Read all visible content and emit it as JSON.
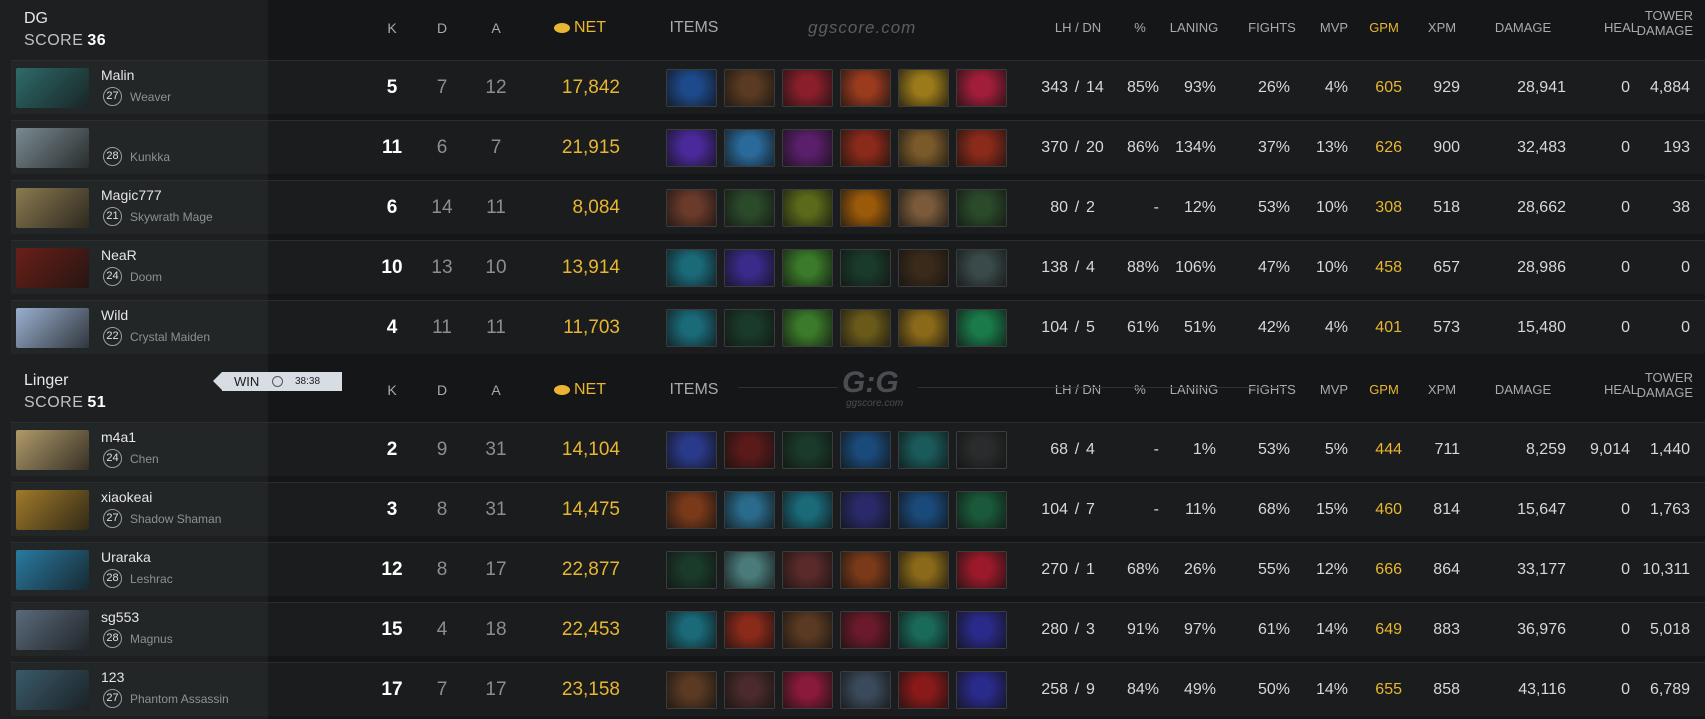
{
  "headers": {
    "k": "K",
    "d": "D",
    "a": "A",
    "net": "NET",
    "items": "ITEMS",
    "lhdn": "LH / DN",
    "pct": "%",
    "laning": "LANING",
    "fights": "FIGHTS",
    "mvp": "MVP",
    "gpm": "GPM",
    "xpm": "XPM",
    "damage": "DAMAGE",
    "heal": "HEAL",
    "tower1": "TOWER",
    "tower2": "DAMAGE"
  },
  "logo_top": "ggscore.com",
  "logo_mid": "G:G",
  "logo_mid_sub": "ggscore.com",
  "match": {
    "result": "WIN",
    "time": "38:38"
  },
  "teams": [
    {
      "name": "DG",
      "score_label": "SCORE",
      "score": "36",
      "players": [
        {
          "name": "Malin",
          "level": "27",
          "hero": "Weaver",
          "k": "5",
          "d": "7",
          "a": "12",
          "net": "17,842",
          "lh": "343",
          "dn": "14",
          "pct": "85%",
          "laning": "93%",
          "fights": "26%",
          "mvp": "4%",
          "gpm": "605",
          "xpm": "929",
          "damage": "28,941",
          "heal": "0",
          "tower": "4,884",
          "portrait": "#2f6a6a",
          "items": [
            "#1d4a8a",
            "#5a3a22",
            "#8a1f2a",
            "#9a3b1e",
            "#9a7a1a",
            "#a01e3a"
          ]
        },
        {
          "name": "",
          "level": "28",
          "hero": "Kunkka",
          "k": "11",
          "d": "6",
          "a": "7",
          "net": "21,915",
          "lh": "370",
          "dn": "20",
          "pct": "86%",
          "laning": "134%",
          "fights": "37%",
          "mvp": "13%",
          "gpm": "626",
          "xpm": "900",
          "damage": "32,483",
          "heal": "0",
          "tower": "193",
          "portrait": "#7a8a90",
          "items": [
            "#4a2a9a",
            "#2a6a9a",
            "#5a1f6a",
            "#8a2a1a",
            "#7a5a2a",
            "#8a2a1a"
          ]
        },
        {
          "name": "Magic777",
          "level": "21",
          "hero": "Skywrath Mage",
          "k": "6",
          "d": "14",
          "a": "11",
          "net": "8,084",
          "lh": "80",
          "dn": "2",
          "pct": "-",
          "laning": "12%",
          "fights": "53%",
          "mvp": "10%",
          "gpm": "308",
          "xpm": "518",
          "damage": "28,662",
          "heal": "0",
          "tower": "38",
          "portrait": "#8a7a50",
          "items": [
            "#6a3a2a",
            "#2a4a2a",
            "#5a6a1a",
            "#9a5a0a",
            "#7a5a3a",
            "#2a4a2a"
          ]
        },
        {
          "name": "NeaR",
          "level": "24",
          "hero": "Doom",
          "k": "10",
          "d": "13",
          "a": "10",
          "net": "13,914",
          "lh": "138",
          "dn": "4",
          "pct": "88%",
          "laning": "106%",
          "fights": "47%",
          "mvp": "10%",
          "gpm": "458",
          "xpm": "657",
          "damage": "28,986",
          "heal": "0",
          "tower": "0",
          "portrait": "#6a2018",
          "items": [
            "#1a6a7a",
            "#3a2a8a",
            "#3a7a2a",
            "#1a3a2a",
            "#3a2a1a",
            "#3a4a4a"
          ]
        },
        {
          "name": "Wild",
          "level": "22",
          "hero": "Crystal Maiden",
          "k": "4",
          "d": "11",
          "a": "11",
          "net": "11,703",
          "lh": "104",
          "dn": "5",
          "pct": "61%",
          "laning": "51%",
          "fights": "42%",
          "mvp": "4%",
          "gpm": "401",
          "xpm": "573",
          "damage": "15,480",
          "heal": "0",
          "tower": "0",
          "portrait": "#9ab0d0",
          "items": [
            "#1a6a7a",
            "#1a3a2a",
            "#3a7a2a",
            "#6a5a1a",
            "#8a6a1a",
            "#1a7a4a"
          ]
        }
      ]
    },
    {
      "name": "Linger",
      "score_label": "SCORE",
      "score": "51",
      "players": [
        {
          "name": "m4a1",
          "level": "24",
          "hero": "Chen",
          "k": "2",
          "d": "9",
          "a": "31",
          "net": "14,104",
          "lh": "68",
          "dn": "4",
          "pct": "-",
          "laning": "1%",
          "fights": "53%",
          "mvp": "5%",
          "gpm": "444",
          "xpm": "711",
          "damage": "8,259",
          "heal": "9,014",
          "tower": "1,440",
          "portrait": "#b09a6a",
          "items": [
            "#2a3a8a",
            "#5a1a1a",
            "#1a3a2a",
            "#1a4a7a",
            "#1a5a5a",
            "#2a2b2c"
          ]
        },
        {
          "name": "xiaokeai",
          "level": "27",
          "hero": "Shadow Shaman",
          "k": "3",
          "d": "8",
          "a": "31",
          "net": "14,475",
          "lh": "104",
          "dn": "7",
          "pct": "-",
          "laning": "11%",
          "fights": "68%",
          "mvp": "15%",
          "gpm": "460",
          "xpm": "814",
          "damage": "15,647",
          "heal": "0",
          "tower": "1,763",
          "portrait": "#a07a2a",
          "items": [
            "#7a3a1a",
            "#2a6a8a",
            "#1a6a7a",
            "#2a2a6a",
            "#1a4a7a",
            "#1a5a3a"
          ]
        },
        {
          "name": "Uraraka",
          "level": "28",
          "hero": "Leshrac",
          "k": "12",
          "d": "8",
          "a": "17",
          "net": "22,877",
          "lh": "270",
          "dn": "1",
          "pct": "68%",
          "laning": "26%",
          "fights": "55%",
          "mvp": "12%",
          "gpm": "666",
          "xpm": "864",
          "damage": "33,177",
          "heal": "0",
          "tower": "10,311",
          "portrait": "#2a7aa0",
          "items": [
            "#1a3a2a",
            "#4a7a7a",
            "#5a2a2a",
            "#7a3a1a",
            "#8a6a1a",
            "#9a1a2a"
          ]
        },
        {
          "name": "sg553",
          "level": "28",
          "hero": "Magnus",
          "k": "15",
          "d": "4",
          "a": "18",
          "net": "22,453",
          "lh": "280",
          "dn": "3",
          "pct": "91%",
          "laning": "97%",
          "fights": "61%",
          "mvp": "14%",
          "gpm": "649",
          "xpm": "883",
          "damage": "36,976",
          "heal": "0",
          "tower": "5,018",
          "portrait": "#5a6a7a",
          "items": [
            "#1a6a7a",
            "#8a2a1a",
            "#5a3a22",
            "#6a1a2a",
            "#1a6a5a",
            "#2a2a8a"
          ]
        },
        {
          "name": "123",
          "level": "27",
          "hero": "Phantom Assassin",
          "k": "17",
          "d": "7",
          "a": "17",
          "net": "23,158",
          "lh": "258",
          "dn": "9",
          "pct": "84%",
          "laning": "49%",
          "fights": "50%",
          "mvp": "14%",
          "gpm": "655",
          "xpm": "858",
          "damage": "43,116",
          "heal": "0",
          "tower": "6,789",
          "portrait": "#3a5a6a",
          "items": [
            "#5a3a22",
            "#4a2a2a",
            "#8a1a3a",
            "#3a4a5a",
            "#8a1a1a",
            "#2a2a8a"
          ]
        }
      ]
    }
  ]
}
